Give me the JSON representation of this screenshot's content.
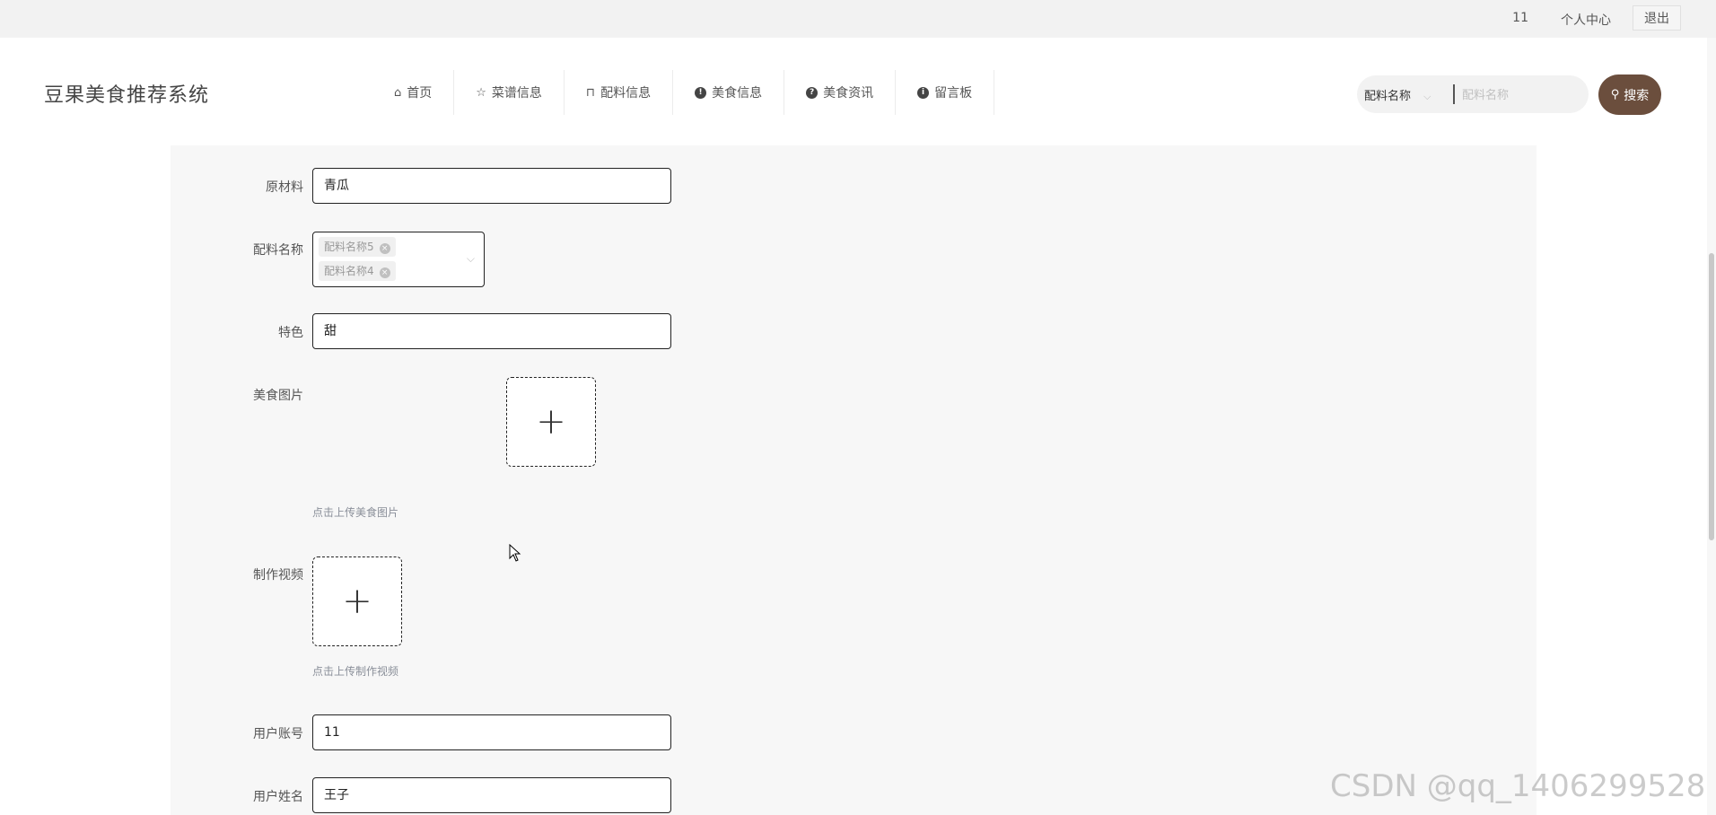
{
  "topbar": {
    "user_id": "11",
    "personal_center": "个人中心",
    "logout": "退出"
  },
  "header": {
    "site_title": "豆果美食推荐系统",
    "nav": [
      {
        "label": "首页",
        "icon": "home-icon"
      },
      {
        "label": "菜谱信息",
        "icon": "star-icon"
      },
      {
        "label": "配料信息",
        "icon": "bag-icon"
      },
      {
        "label": "美食信息",
        "icon": "exclamation-circle-icon"
      },
      {
        "label": "美食资讯",
        "icon": "question-circle-icon"
      },
      {
        "label": "留言板",
        "icon": "info-circle-icon"
      }
    ],
    "search": {
      "select_value": "配料名称",
      "placeholder": "配料名称",
      "button_label": "搜索"
    }
  },
  "form": {
    "raw_material": {
      "label": "原材料",
      "value": "青瓜"
    },
    "ingredient_name": {
      "label": "配料名称",
      "tags": [
        "配料名称5",
        "配料名称4"
      ]
    },
    "feature": {
      "label": "特色",
      "value": "甜"
    },
    "food_image": {
      "label": "美食图片",
      "tip": "点击上传美食图片"
    },
    "video": {
      "label": "制作视频",
      "tip": "点击上传制作视频"
    },
    "user_account": {
      "label": "用户账号",
      "value": "11"
    },
    "user_name": {
      "label": "用户姓名",
      "value": "王子"
    }
  },
  "watermark": "CSDN @qq_1406299528",
  "colors": {
    "accent": "#6b4e3d",
    "panel_bg": "#f7f7f7",
    "topbar_bg": "#f2f2f2"
  }
}
